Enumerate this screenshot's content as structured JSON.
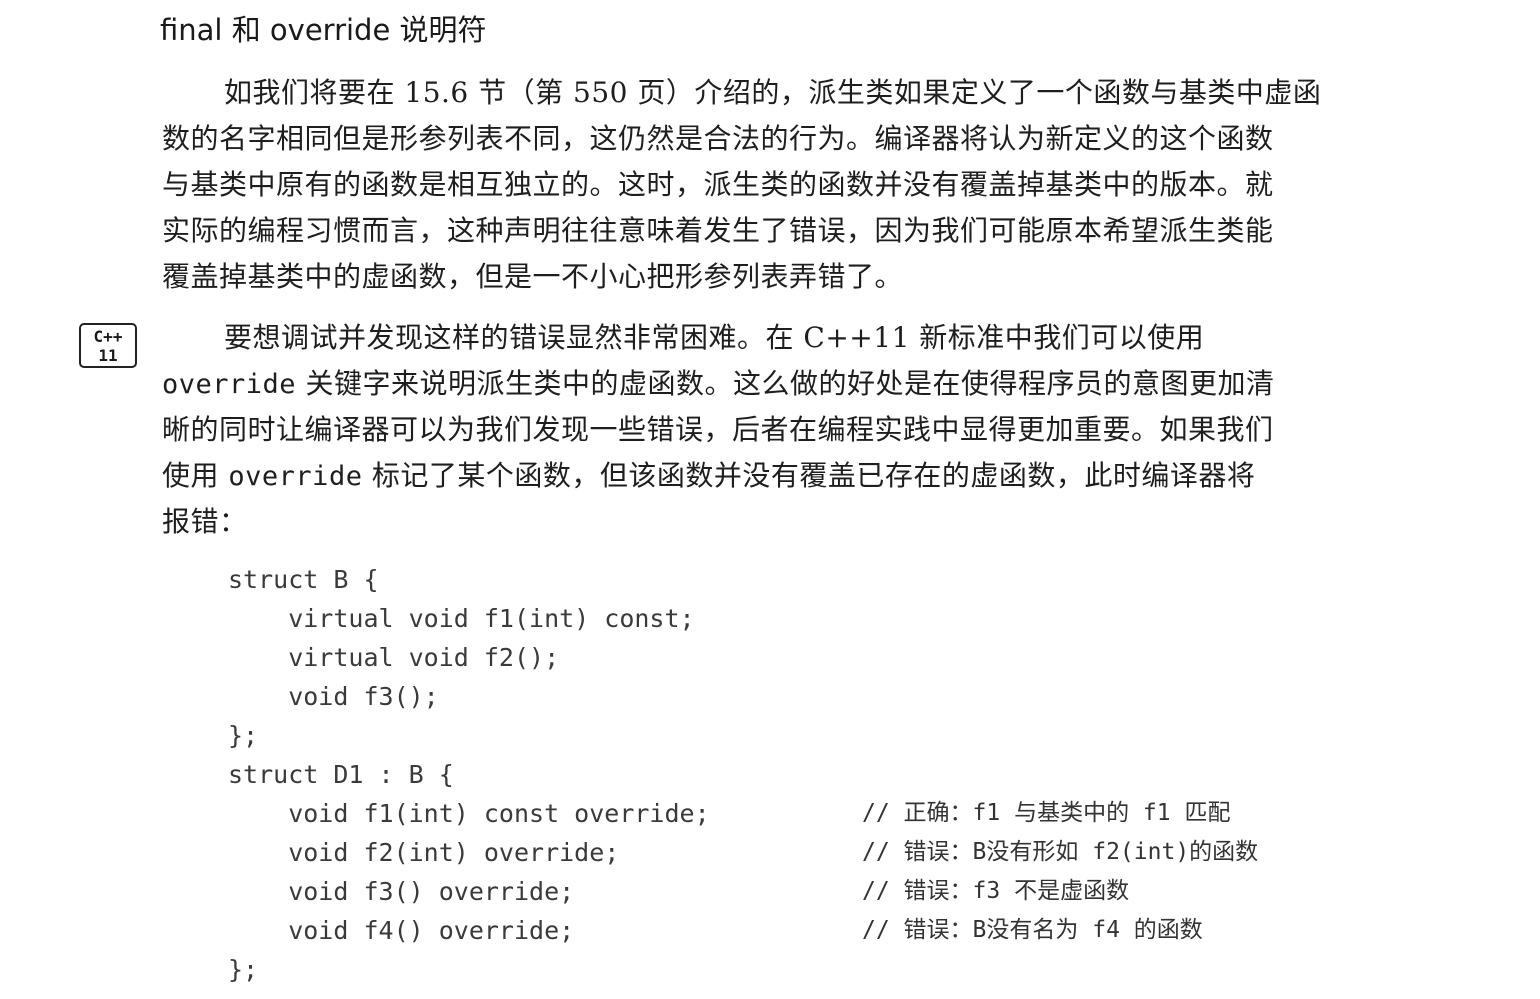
{
  "heading": "final 和 override 说明符",
  "badge": {
    "line1": "C++",
    "line2": "11"
  },
  "paragraph1": [
    "如我们将要在 15.6 节（第 550 页）介绍的，派生类如果定义了一个函数与基类中虚函",
    "数的名字相同但是形参列表不同，这仍然是合法的行为。编译器将认为新定义的这个函数",
    "与基类中原有的函数是相互独立的。这时，派生类的函数并没有覆盖掉基类中的版本。就",
    "实际的编程习惯而言，这种声明往往意味着发生了错误，因为我们可能原本希望派生类能",
    "覆盖掉基类中的虚函数，但是一不小心把形参列表弄错了。"
  ],
  "paragraph2": {
    "line1": "要想调试并发现这样的错误显然非常困难。在 C++11 新标准中我们可以使用",
    "line2_code": "override",
    "line2_rest": " 关键字来说明派生类中的虚函数。这么做的好处是在使得程序员的意图更加清",
    "line3": "晰的同时让编译器可以为我们发现一些错误，后者在编程实践中显得更加重要。如果我们",
    "line4_pre": "使用 ",
    "line4_code": "override",
    "line4_rest": " 标记了某个函数，但该函数并没有覆盖已存在的虚函数，此时编译器将",
    "line5": "报错："
  },
  "code": [
    {
      "text": "struct B {",
      "comment": ""
    },
    {
      "text": "    virtual void f1(int) const;",
      "comment": ""
    },
    {
      "text": "    virtual void f2();",
      "comment": ""
    },
    {
      "text": "    void f3();",
      "comment": ""
    },
    {
      "text": "};",
      "comment": ""
    },
    {
      "text": "struct D1 : B {",
      "comment": ""
    },
    {
      "text": "    void f1(int) const override;",
      "comment": "// 正确：f1 与基类中的 f1 匹配"
    },
    {
      "text": "    void f2(int) override;",
      "comment": "// 错误：B没有形如 f2(int)的函数"
    },
    {
      "text": "    void f3() override;",
      "comment": "// 错误：f3 不是虚函数"
    },
    {
      "text": "    void f4() override;",
      "comment": "// 错误：B没有名为 f4 的函数"
    },
    {
      "text": "};",
      "comment": ""
    }
  ]
}
